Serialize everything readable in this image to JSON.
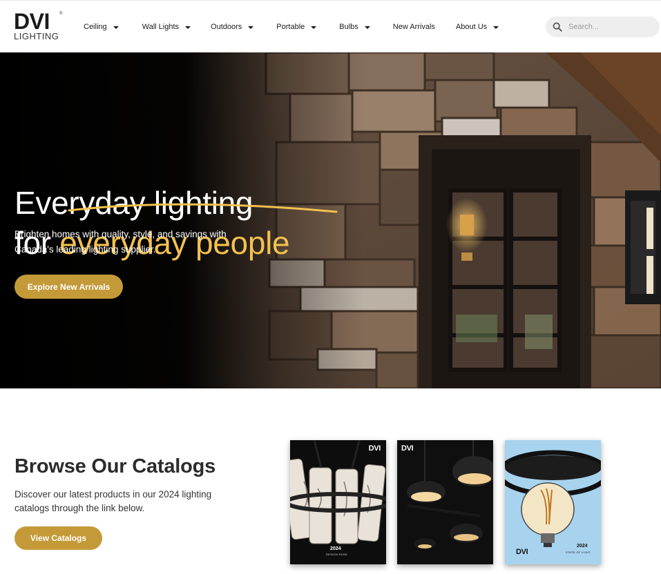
{
  "header": {
    "logo": {
      "brand": "DVI",
      "subtitle": "LIGHTING",
      "registered": "®"
    },
    "nav": [
      {
        "label": "Ceiling",
        "dropdown": true
      },
      {
        "label": "Wall Lights",
        "dropdown": true
      },
      {
        "label": "Outdoors",
        "dropdown": true
      },
      {
        "label": "Portable",
        "dropdown": true
      },
      {
        "label": "Bulbs",
        "dropdown": true
      },
      {
        "label": "New Arrivals",
        "dropdown": false
      },
      {
        "label": "About Us",
        "dropdown": true
      }
    ],
    "search": {
      "placeholder": "Search...",
      "value": ""
    }
  },
  "hero": {
    "title_line1": "Everyday lighting",
    "title_line2_prefix": "for ",
    "title_line2_accent": "everyday people",
    "subtitle": "Brighten homes with quality, style, and savings with Canada's leading lighting supplier.",
    "button_label": "Explore New Arrivals"
  },
  "catalogs": {
    "title": "Browse Our Catalogs",
    "description": "Discover our latest products in our 2024 lighting catalogs through the link below.",
    "button_label": "View Catalogs",
    "covers": [
      {
        "brand": "DVI",
        "year": "2024",
        "caption": "DESIGN EDGE"
      },
      {
        "brand": "DVI",
        "year": "",
        "caption": ""
      },
      {
        "brand": "DVI",
        "year": "2024",
        "caption": "STATE OF LIGHT"
      }
    ]
  },
  "colors": {
    "accent_gold": "#c49a38",
    "accent_yellow": "#f2c14e",
    "hero_bg": "#000000",
    "text_dark": "#2b2b2b"
  },
  "icons": {
    "search": "search-icon",
    "dropdown": "caret-down-icon"
  }
}
